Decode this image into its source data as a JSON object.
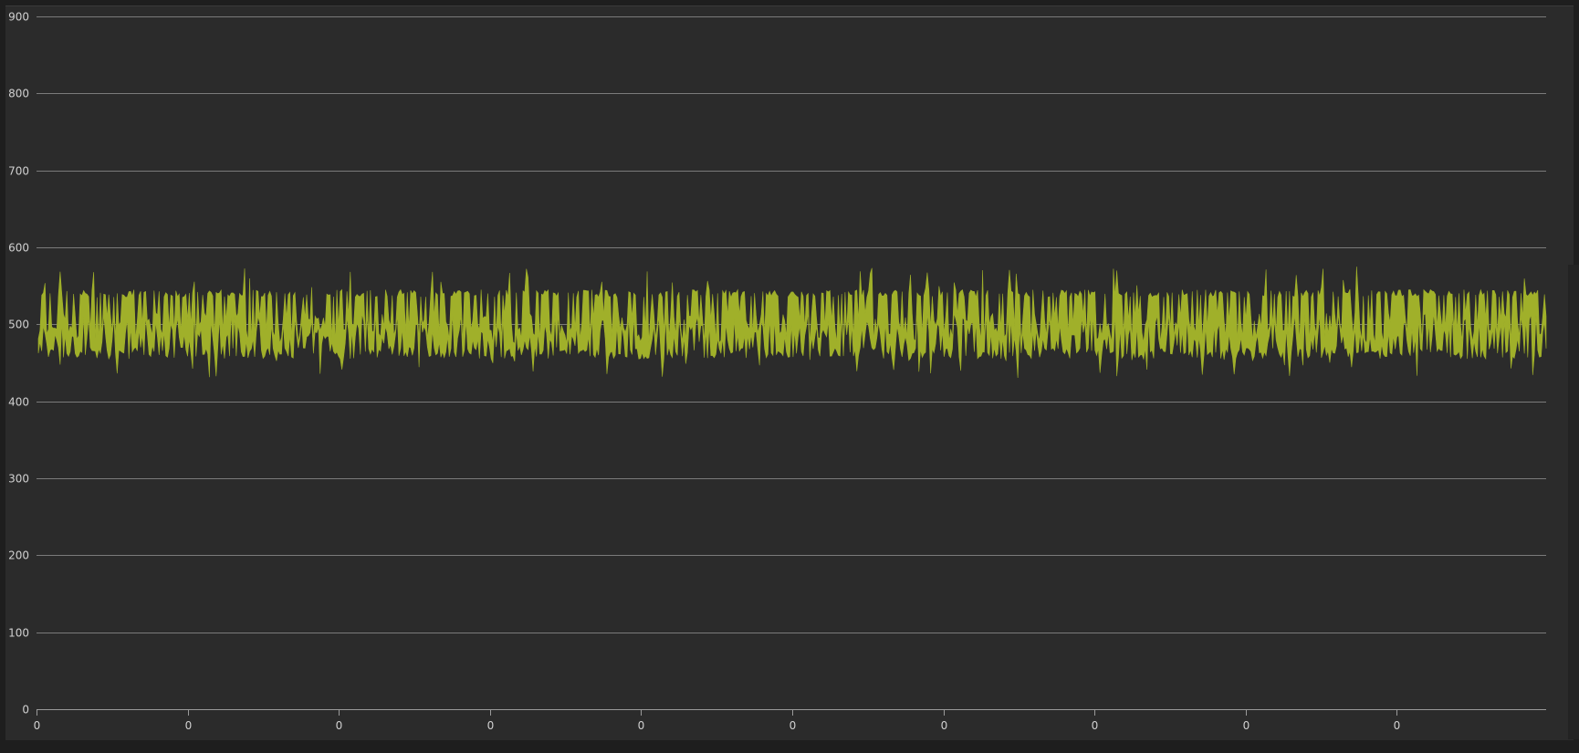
{
  "colors": {
    "background": "#2b2b2b",
    "series": "#a0b02a",
    "grid": "#8a8a8a",
    "text": "#d0d0d0"
  },
  "chart_data": {
    "type": "area",
    "title": "",
    "xlabel": "",
    "ylabel": "",
    "ylim": [
      0,
      900
    ],
    "yticks": [
      0,
      100,
      200,
      300,
      400,
      500,
      600,
      700,
      800,
      900
    ],
    "xtick_labels": [
      "0",
      "0",
      "0",
      "0",
      "0",
      "0",
      "0",
      "0",
      "0",
      "0"
    ],
    "grid": true,
    "legend": "none",
    "series": [
      {
        "band": true,
        "color": "#a0b02a",
        "n_points": 900,
        "upper_typical": [
          535,
          545
        ],
        "lower_typical": [
          455,
          470
        ],
        "upper_max": 575,
        "lower_min": 430,
        "mean": 500
      }
    ]
  }
}
